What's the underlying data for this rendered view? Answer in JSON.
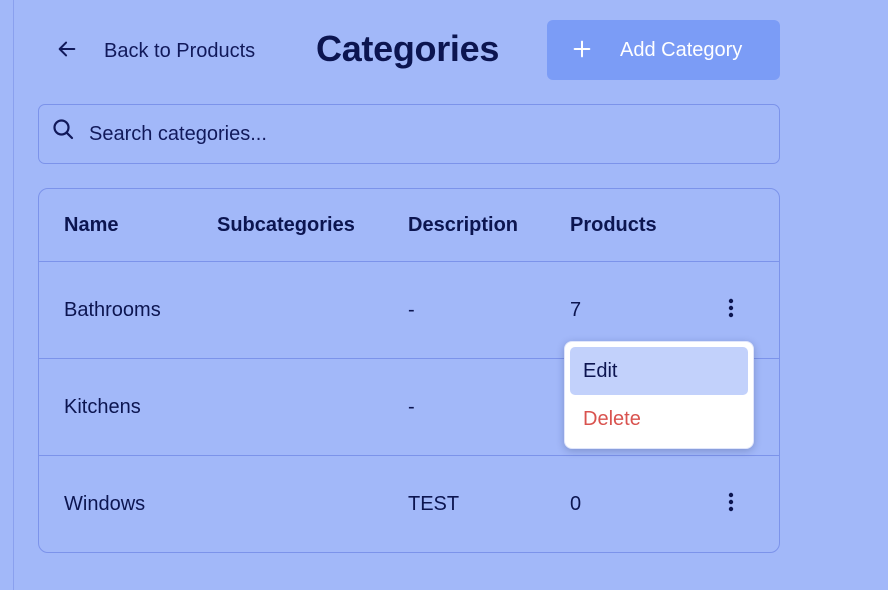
{
  "header": {
    "back_label": "Back to Products",
    "title": "Categories",
    "add_button_label": "Add Category"
  },
  "search": {
    "placeholder": "Search categories...",
    "value": ""
  },
  "table": {
    "columns": [
      "Name",
      "Subcategories",
      "Description",
      "Products"
    ],
    "rows": [
      {
        "name": "Bathrooms",
        "subcategories": "",
        "description": "-",
        "products": "7"
      },
      {
        "name": "Kitchens",
        "subcategories": "",
        "description": "-",
        "products": ""
      },
      {
        "name": "Windows",
        "subcategories": "",
        "description": "TEST",
        "products": "0"
      }
    ]
  },
  "row_menu": {
    "items": [
      "Edit",
      "Delete"
    ],
    "highlighted": "Edit"
  },
  "colors": {
    "background": "#a2b8f9",
    "accent": "#7b9cf6",
    "danger": "#d9534f",
    "text": "#0c1550"
  },
  "icons": [
    "arrow-left-icon",
    "plus-icon",
    "search-icon",
    "kebab-menu-icon"
  ]
}
